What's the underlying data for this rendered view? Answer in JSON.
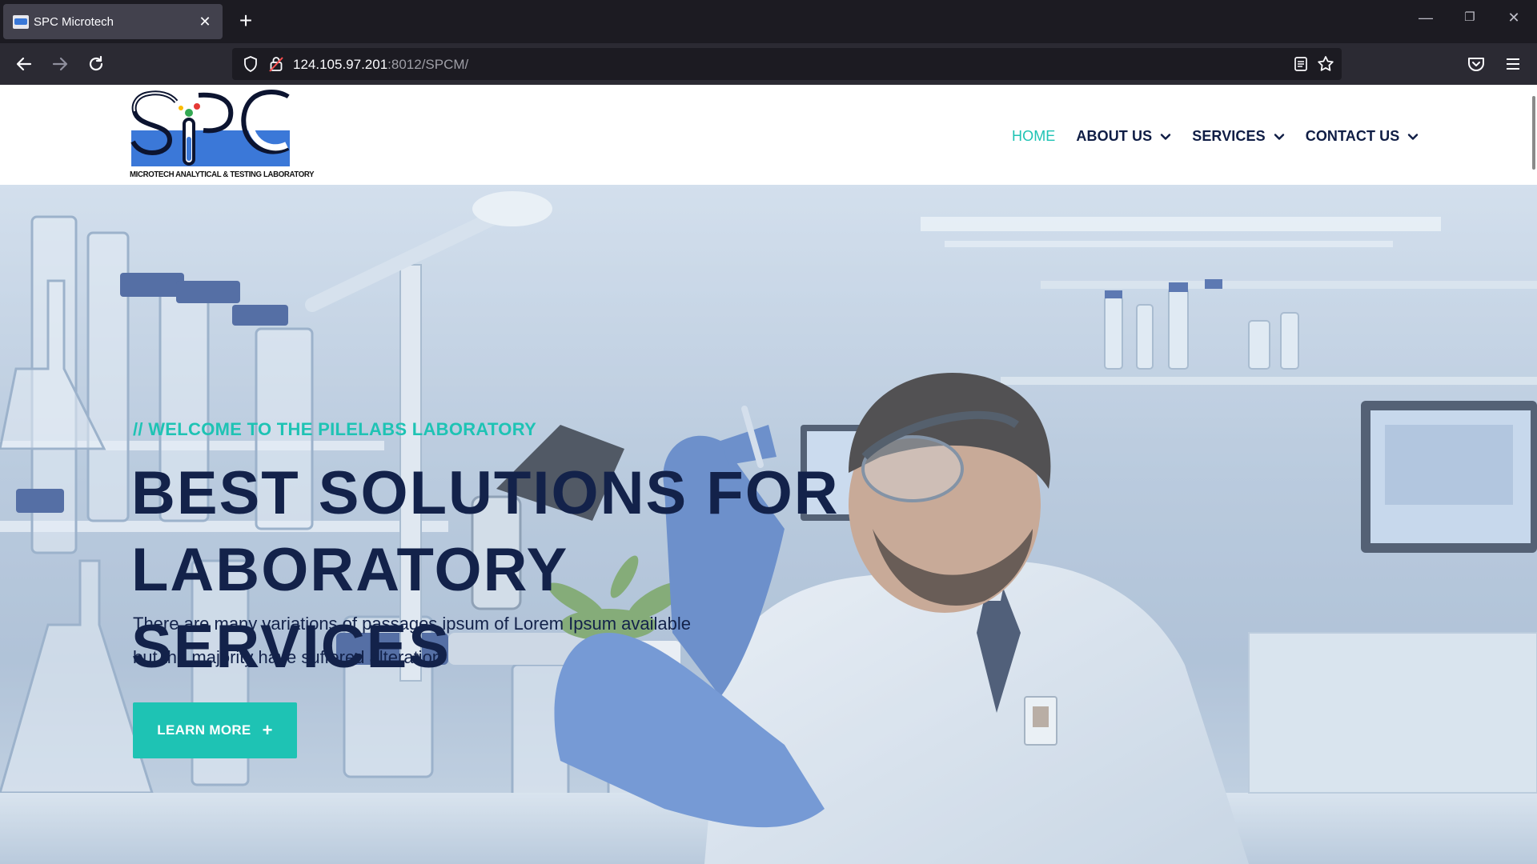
{
  "browser": {
    "tab_title": "SPC Microtech",
    "tab_close": "✕",
    "new_tab": "+",
    "url_host": "124.105.97.201",
    "url_path": ":8012/SPCM/",
    "window_controls": {
      "minimize": "—",
      "restore": "❐",
      "close": "✕"
    },
    "icons": [
      "back-icon",
      "forward-icon",
      "reload-icon",
      "shield-icon",
      "lock-icon",
      "reader-view-icon",
      "bookmark-star-icon",
      "pocket-icon",
      "menu-icon"
    ]
  },
  "site": {
    "logo_caption": "MICROTECH ANALYTICAL & TESTING LABORATORY",
    "logo_letters": "SPC",
    "nav": [
      {
        "label": "HOME",
        "active": true,
        "dropdown": false
      },
      {
        "label": "ABOUT US",
        "active": false,
        "dropdown": true
      },
      {
        "label": "SERVICES",
        "active": false,
        "dropdown": true
      },
      {
        "label": "CONTACT US",
        "active": false,
        "dropdown": true
      }
    ],
    "accent_color": "#1ec3b4",
    "heading_color": "#13224a"
  },
  "hero": {
    "kicker": "// WELCOME TO THE PILELABS LABORATORY",
    "title_line1": "BEST SOLUTIONS FOR",
    "title_line2": "LABORATORY SERVICES",
    "text_line1": "There are many variations of passages ipsum of Lorem Ipsum available",
    "text_line2": "but the majority have suffered alteration",
    "button_label": "LEARN MORE",
    "button_icon": "+"
  }
}
